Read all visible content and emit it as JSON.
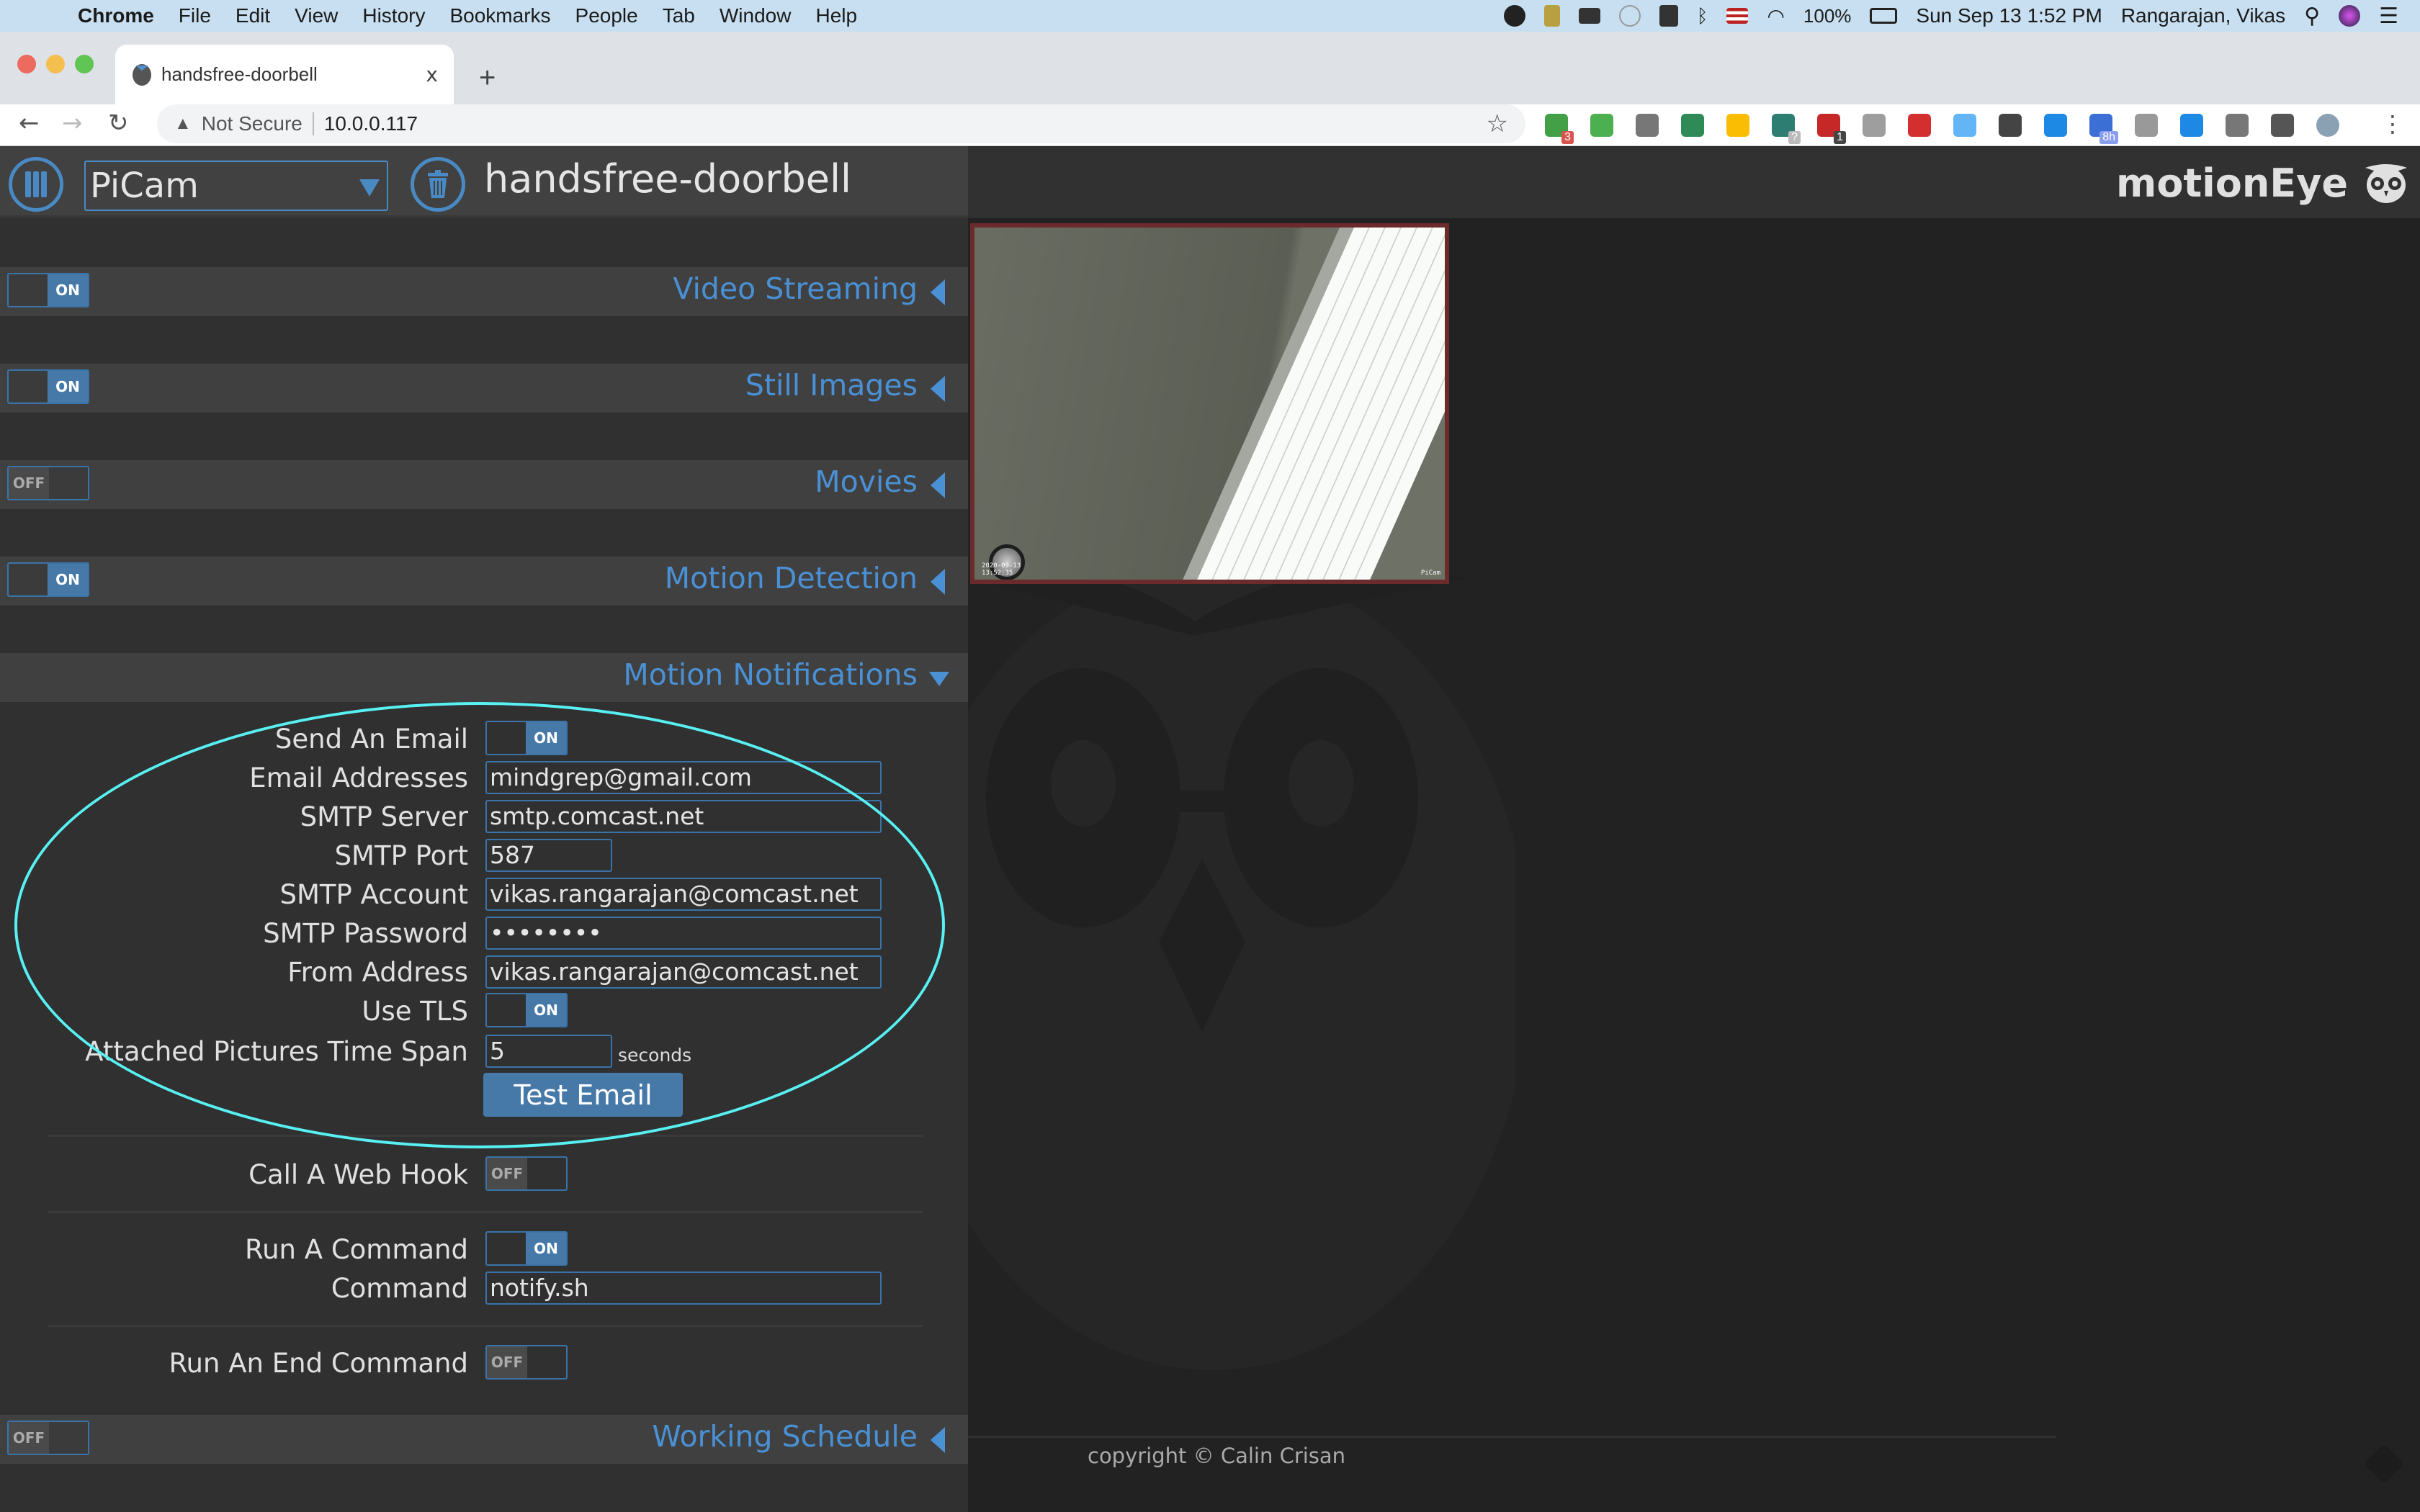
{
  "menubar": {
    "app": "Chrome",
    "items": [
      "File",
      "Edit",
      "View",
      "History",
      "Bookmarks",
      "People",
      "Tab",
      "Window",
      "Help"
    ],
    "status": {
      "battery": "100%",
      "datetime": "Sun Sep 13  1:52 PM",
      "user": "Rangarajan, Vikas"
    }
  },
  "browser": {
    "tab_title": "handsfree-doorbell",
    "tab_close": "x",
    "new_tab": "+",
    "security_label": "Not Secure",
    "url": "10.0.0.117",
    "extensions": [
      {
        "name": "pushbullet-ext",
        "color": "#43a047",
        "badge": "3",
        "badge_color": "#d9534f"
      },
      {
        "name": "evernote-ext",
        "color": "#4caf50"
      },
      {
        "name": "pocket-ext",
        "color": "#777777"
      },
      {
        "name": "sync-ext",
        "color": "#2e8b57"
      },
      {
        "name": "google-drive-ext",
        "color": "#fbbc04"
      },
      {
        "name": "phone-ext",
        "color": "#2e7d72",
        "badge": "?",
        "badge_color": "#bbbbbb"
      },
      {
        "name": "lastpass-ext",
        "color": "#c62828",
        "badge": "1",
        "badge_color": "#444444"
      },
      {
        "name": "video-chat-ext",
        "color": "#9e9e9e"
      },
      {
        "name": "adblock-ext",
        "color": "#d32f2f"
      },
      {
        "name": "vimeo-ext",
        "color": "#64b5f6"
      },
      {
        "name": "dark-mode-ext",
        "color": "#444444"
      },
      {
        "name": "chat-bubble-ext",
        "color": "#1e88e5"
      },
      {
        "name": "calendar-ext",
        "color": "#3b6fd6",
        "badge": "8h",
        "badge_color": "#8a9ef0"
      },
      {
        "name": "gear-ext",
        "color": "#999999"
      },
      {
        "name": "clock-ext",
        "color": "#1e88e5"
      },
      {
        "name": "bookmark-ext",
        "color": "#777777"
      },
      {
        "name": "puzzle-ext",
        "color": "#555555"
      },
      {
        "name": "profile-avatar",
        "color": "#8aa1b3"
      }
    ]
  },
  "motioneye": {
    "brand": "motionEye",
    "camera_select": "PiCam",
    "camera_name": "handsfree-doorbell",
    "sections": [
      {
        "title": "Video Streaming",
        "toggle": "ON",
        "state": "collapsed"
      },
      {
        "title": "Still Images",
        "toggle": "ON",
        "state": "collapsed"
      },
      {
        "title": "Movies",
        "toggle": "OFF",
        "state": "collapsed"
      },
      {
        "title": "Motion Detection",
        "toggle": "ON",
        "state": "collapsed"
      },
      {
        "title": "Motion Notifications",
        "state": "expanded"
      },
      {
        "title": "Working Schedule",
        "toggle": "OFF",
        "state": "collapsed"
      }
    ],
    "notifications": {
      "send_email": {
        "label": "Send An Email",
        "value": "ON"
      },
      "email_addresses": {
        "label": "Email Addresses",
        "value": "mindgrep@gmail.com"
      },
      "smtp_server": {
        "label": "SMTP Server",
        "value": "smtp.comcast.net"
      },
      "smtp_port": {
        "label": "SMTP Port",
        "value": "587"
      },
      "smtp_account": {
        "label": "SMTP Account",
        "value": "vikas.rangarajan@comcast.net"
      },
      "smtp_password": {
        "label": "SMTP Password",
        "value": "••••••••"
      },
      "from_address": {
        "label": "From Address",
        "value": "vikas.rangarajan@comcast.net"
      },
      "use_tls": {
        "label": "Use TLS",
        "value": "ON"
      },
      "time_span": {
        "label": "Attached Pictures Time Span",
        "value": "5",
        "unit": "seconds"
      },
      "test_email": "Test Email",
      "web_hook": {
        "label": "Call A Web Hook",
        "value": "OFF"
      },
      "run_command": {
        "label": "Run A Command",
        "value": "ON"
      },
      "command": {
        "label": "Command",
        "value": "notify.sh"
      },
      "end_command": {
        "label": "Run An End Command",
        "value": "OFF"
      }
    },
    "camera_frame": {
      "timestamp_date": "2020-09-13",
      "timestamp_time": "13:52:35",
      "label": "PiCam"
    },
    "footer": "copyright © Calin Crisan",
    "colors": {
      "accent": "#4a90d4",
      "toggle_on": "#4679a8",
      "highlight": "#58f0f2",
      "frame_border": "#6b2a2c"
    }
  }
}
